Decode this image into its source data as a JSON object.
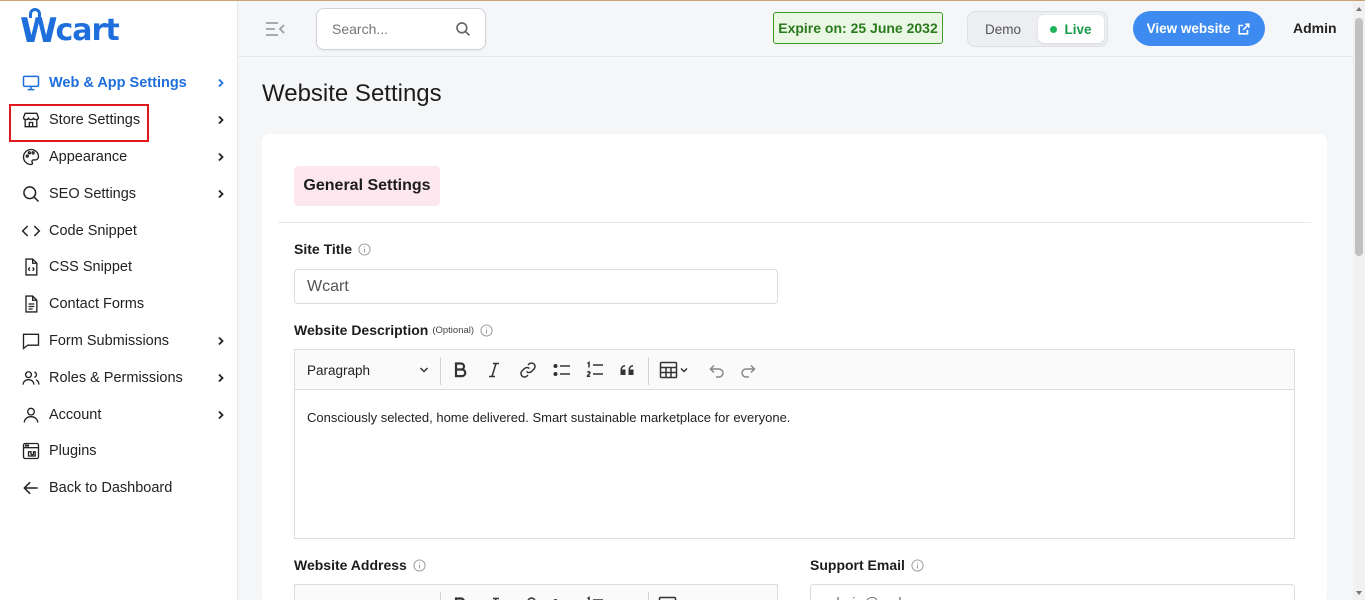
{
  "brand": {
    "logo_text_w": "W",
    "logo_text_rest": "cart"
  },
  "sidebar": {
    "items": [
      {
        "label": "Web & App Settings",
        "icon": "monitor-icon",
        "chevron": true,
        "active": true
      },
      {
        "label": "Store Settings",
        "icon": "store-icon",
        "chevron": true,
        "highlighted": true
      },
      {
        "label": "Appearance",
        "icon": "palette-icon",
        "chevron": true
      },
      {
        "label": "SEO Settings",
        "icon": "search-icon",
        "chevron": true
      },
      {
        "label": "Code Snippet",
        "icon": "code-icon",
        "chevron": false
      },
      {
        "label": "CSS Snippet",
        "icon": "css-file-icon",
        "chevron": false
      },
      {
        "label": "Contact Forms",
        "icon": "document-icon",
        "chevron": false
      },
      {
        "label": "Form Submissions",
        "icon": "message-icon",
        "chevron": true
      },
      {
        "label": "Roles & Permissions",
        "icon": "users-icon",
        "chevron": true
      },
      {
        "label": "Account",
        "icon": "user-icon",
        "chevron": true
      },
      {
        "label": "Plugins",
        "icon": "plugin-icon",
        "chevron": false
      },
      {
        "label": "Back to Dashboard",
        "icon": "arrow-left-icon",
        "chevron": false
      }
    ]
  },
  "header": {
    "search_placeholder": "Search...",
    "expire_text": "Expire on: 25 June 2032",
    "mode_demo": "Demo",
    "mode_live": "Live",
    "view_website": "View website",
    "user": "Admin"
  },
  "main": {
    "page_title": "Website Settings",
    "tab_label": "General Settings",
    "site_title_label": "Site Title",
    "site_title_value": "Wcart",
    "description_label": "Website Description",
    "optional_label": "(Optional)",
    "editor_paragraph": "Paragraph",
    "description_value": "Consciously selected, home delivered. Smart sustainable marketplace for everyone.",
    "address_label": "Website Address",
    "support_email_label": "Support Email",
    "support_email_placeholder": "admin@webnexs.com"
  },
  "colors": {
    "accent": "#1e6fdc",
    "live_green": "#1fb35b",
    "highlight_red": "#e0191f",
    "tab_bg": "#fde7ef"
  }
}
